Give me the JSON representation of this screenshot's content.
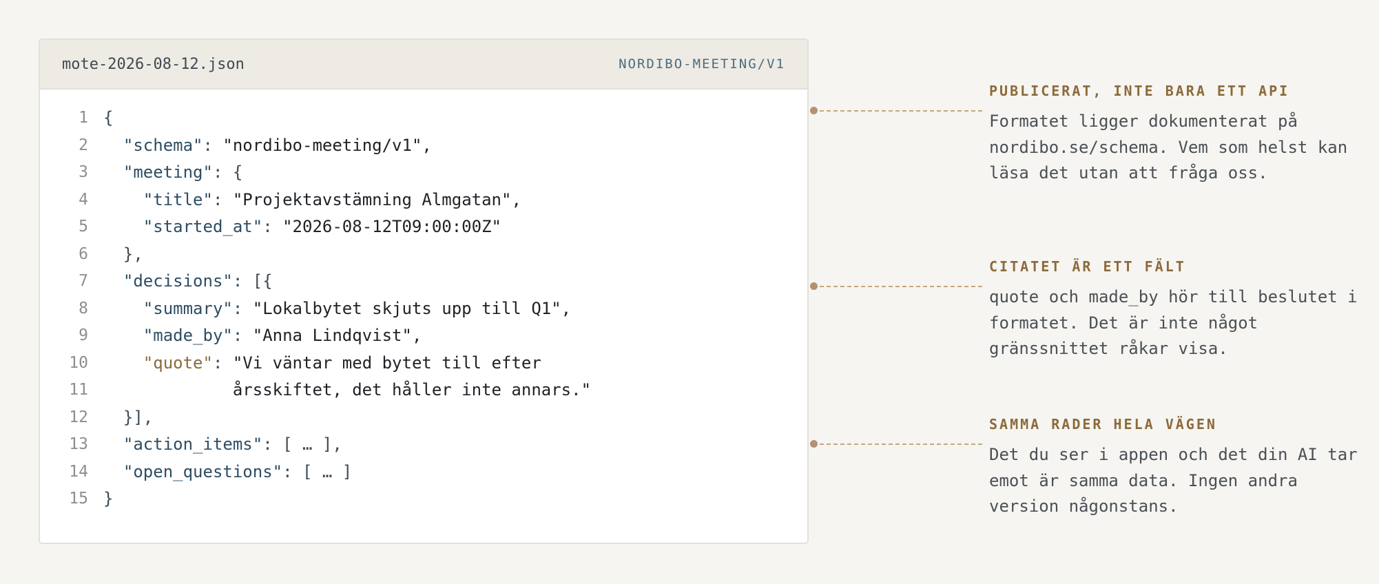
{
  "file": {
    "name": "mote-2026-08-12.json",
    "schema_tag": "NORDIBO-MEETING/V1"
  },
  "code": {
    "line_numbers": [
      "1",
      "2",
      "3",
      "4",
      "5",
      "6",
      "7",
      "8",
      "9",
      "10",
      "11",
      "12",
      "13",
      "14",
      "15"
    ],
    "l1": "{",
    "schema_key": "\"schema\"",
    "schema_val": "\"nordibo-meeting/v1\",",
    "meeting_key": "\"meeting\"",
    "meeting_open": "{",
    "title_key": "\"title\"",
    "title_val": "\"Projektavstämning Almgatan\",",
    "started_key": "\"started_at\"",
    "started_val": "\"2026-08-12T09:00:00Z\"",
    "meeting_close": "},",
    "decisions_key": "\"decisions\"",
    "decisions_open": "[{",
    "summary_key": "\"summary\"",
    "summary_val": "\"Lokalbytet skjuts upp till Q1\",",
    "made_by_key": "\"made_by\"",
    "made_by_val": "\"Anna Lindqvist\",",
    "quote_key": "\"quote\"",
    "quote_val_1": "\"Vi väntar med bytet till efter",
    "quote_val_2": "årsskiftet, det håller inte annars.\"",
    "decisions_close": "}],",
    "action_items_key": "\"action_items\"",
    "action_items_val": "[ … ],",
    "open_questions_key": "\"open_questions\"",
    "open_questions_val": "[ … ]",
    "l15": "}"
  },
  "notes": [
    {
      "title": "PUBLICERAT, INTE BARA ETT API",
      "body": "Formatet ligger dokumenterat på nordibo.se/schema. Vem som helst kan läsa det utan att fråga oss."
    },
    {
      "title": "CITATET ÄR ETT FÄLT",
      "body": "quote och made_by hör till beslutet i formatet. Det är inte något gränssnittet råkar visa."
    },
    {
      "title": "SAMMA RADER HELA VÄGEN",
      "body": "Det du ser i appen och det din AI tar emot är samma data. Ingen andra version någonstans."
    }
  ]
}
